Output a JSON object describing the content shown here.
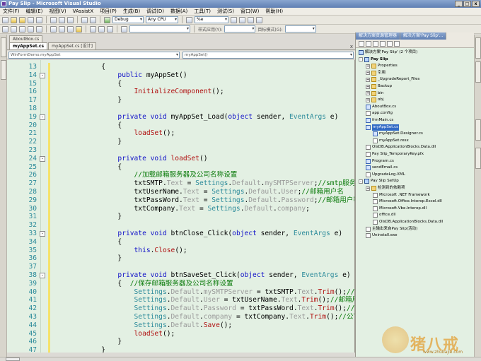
{
  "window": {
    "title": "Pay Slip - Microsoft Visual Studio"
  },
  "menu": [
    "文件(F)",
    "编辑(E)",
    "视图(V)",
    "VAssistX",
    "项目(P)",
    "生成(B)",
    "调试(D)",
    "数据(A)",
    "工具(T)",
    "测试(S)",
    "窗口(W)",
    "帮助(H)"
  ],
  "toolbar": {
    "config": "Debug",
    "platform": "Any CPU",
    "search": "%e",
    "style_apply_label": "样式应用(Y):",
    "target_schema_label": "目标模式(G):"
  },
  "doc_tabs_row1": [
    {
      "label": "AboutBox.cs",
      "active": false
    }
  ],
  "doc_tabs_row2": [
    {
      "label": "myAppSet.cs",
      "active": true
    },
    {
      "label": "myAppSet.cs [设计]",
      "active": false
    }
  ],
  "nav": {
    "left": "WinFormDemo.myAppSet",
    "right": "myAppSet()"
  },
  "code_lines": [
    {
      "n": "13",
      "t": "            {"
    },
    {
      "n": "14",
      "t": "                public myAppSet()"
    },
    {
      "n": "15",
      "t": "                {"
    },
    {
      "n": "16",
      "t": "                    InitializeComponent();"
    },
    {
      "n": "17",
      "t": "                }"
    },
    {
      "n": "18",
      "t": ""
    },
    {
      "n": "19",
      "t": "                private void myAppSet_Load(object sender, EventArgs e)"
    },
    {
      "n": "20",
      "t": "                {"
    },
    {
      "n": "21",
      "t": "                    loadSet();"
    },
    {
      "n": "22",
      "t": "                }"
    },
    {
      "n": "23",
      "t": ""
    },
    {
      "n": "24",
      "t": "                private void loadSet()"
    },
    {
      "n": "25",
      "t": "                {"
    },
    {
      "n": "26",
      "t": "                    //加载邮箱服务器及公司名称设置"
    },
    {
      "n": "27",
      "t": "                    txtSMTP.Text = Settings.Default.mySMTPServer;//smtp服务器地址"
    },
    {
      "n": "28",
      "t": "                    txtUserName.Text = Settings.Default.User;//邮箱用户名"
    },
    {
      "n": "29",
      "t": "                    txtPassWord.Text = Settings.Default.Password;//邮箱用户密码"
    },
    {
      "n": "30",
      "t": "                    txtCompany.Text = Settings.Default.company;"
    },
    {
      "n": "31",
      "t": "                }"
    },
    {
      "n": "32",
      "t": ""
    },
    {
      "n": "33",
      "t": "                private void btnClose_Click(object sender, EventArgs e)"
    },
    {
      "n": "34",
      "t": "                {"
    },
    {
      "n": "35",
      "t": "                    this.Close();"
    },
    {
      "n": "36",
      "t": "                }"
    },
    {
      "n": "37",
      "t": ""
    },
    {
      "n": "38",
      "t": "                private void btnSaveSet_Click(object sender, EventArgs e)"
    },
    {
      "n": "39",
      "t": "                {  //保存邮箱服务器及公司名称设置"
    },
    {
      "n": "40",
      "t": "                    Settings.Default.mySMTPServer = txtSMTP.Text.Trim();//smtp服务器"
    },
    {
      "n": "41",
      "t": "                    Settings.Default.User = txtUserName.Text.Trim();//邮箱用户名"
    },
    {
      "n": "42",
      "t": "                    Settings.Default.Password = txtPassWord.Text.Trim();//邮箱用户密"
    },
    {
      "n": "43",
      "t": "                    Settings.Default.company = txtCompany.Text.Trim();//公司名称"
    },
    {
      "n": "44",
      "t": "                    Settings.Default.Save();"
    },
    {
      "n": "45",
      "t": "                    loadSet();"
    },
    {
      "n": "46",
      "t": "                }"
    },
    {
      "n": "47",
      "t": "            }"
    }
  ],
  "solution_panel": {
    "tabs": [
      "解决方案资源管理器",
      "解决方案'Pay Slip'..."
    ],
    "items": [
      {
        "label": "解决方案'Pay Slip' (2 个项目)",
        "icon": "solution-icon",
        "level": 0
      },
      {
        "label": "Pay Slip",
        "icon": "project-icon",
        "level": 0,
        "bold": true
      },
      {
        "label": "Properties",
        "icon": "folder-icon",
        "level": 1
      },
      {
        "label": "引用",
        "icon": "folder-icon",
        "level": 1
      },
      {
        "label": "_UpgradeReport_Files",
        "icon": "folder-icon",
        "level": 1
      },
      {
        "label": "Backup",
        "icon": "folder-icon",
        "level": 1
      },
      {
        "label": "bin",
        "icon": "folder-icon",
        "level": 1
      },
      {
        "label": "obj",
        "icon": "folder-icon",
        "level": 1
      },
      {
        "label": "AboutBox.cs",
        "icon": "cs-file-icon",
        "level": 1
      },
      {
        "label": "app.config",
        "icon": "file-icon",
        "level": 1
      },
      {
        "label": "frmMain.cs",
        "icon": "cs-file-icon",
        "level": 1
      },
      {
        "label": "myAppSet.cs",
        "icon": "cs-file-icon",
        "level": 1,
        "selected": true
      },
      {
        "label": "myAppSet.Designer.cs",
        "icon": "cs-file-icon",
        "level": 2
      },
      {
        "label": "myAppSet.resx",
        "icon": "file-icon",
        "level": 2
      },
      {
        "label": "OlsDB.ApplicationBlocks.Data.dll",
        "icon": "file-icon",
        "level": 1
      },
      {
        "label": "Pay Slip_TemporaryKey.pfx",
        "icon": "file-icon",
        "level": 1
      },
      {
        "label": "Program.cs",
        "icon": "cs-file-icon",
        "level": 1
      },
      {
        "label": "sendEmail.cs",
        "icon": "cs-file-icon",
        "level": 1
      },
      {
        "label": "UpgradeLog.XML",
        "icon": "file-icon",
        "level": 1
      },
      {
        "label": "Pay Slip SetUp",
        "icon": "project-icon",
        "level": 0
      },
      {
        "label": "检测到的依赖项",
        "icon": "folder-icon",
        "level": 1
      },
      {
        "label": "Microsoft .NET Framework",
        "icon": "file-icon",
        "level": 2
      },
      {
        "label": "Microsoft.Office.Interop.Excel.dll",
        "icon": "file-icon",
        "level": 2
      },
      {
        "label": "Microsoft.Vbe.Interop.dll",
        "icon": "file-icon",
        "level": 2
      },
      {
        "label": "office.dll",
        "icon": "file-icon",
        "level": 2
      },
      {
        "label": "OlsDB.ApplicationBlocks.Data.dll",
        "icon": "file-icon",
        "level": 2
      },
      {
        "label": "主输出来自Pay Slip(活动)",
        "icon": "file-icon",
        "level": 1
      },
      {
        "label": "Uninstall.exe",
        "icon": "file-icon",
        "level": 1
      }
    ]
  },
  "watermark": {
    "text": "猪八戒",
    "sub": "www.zhubajie.com"
  }
}
